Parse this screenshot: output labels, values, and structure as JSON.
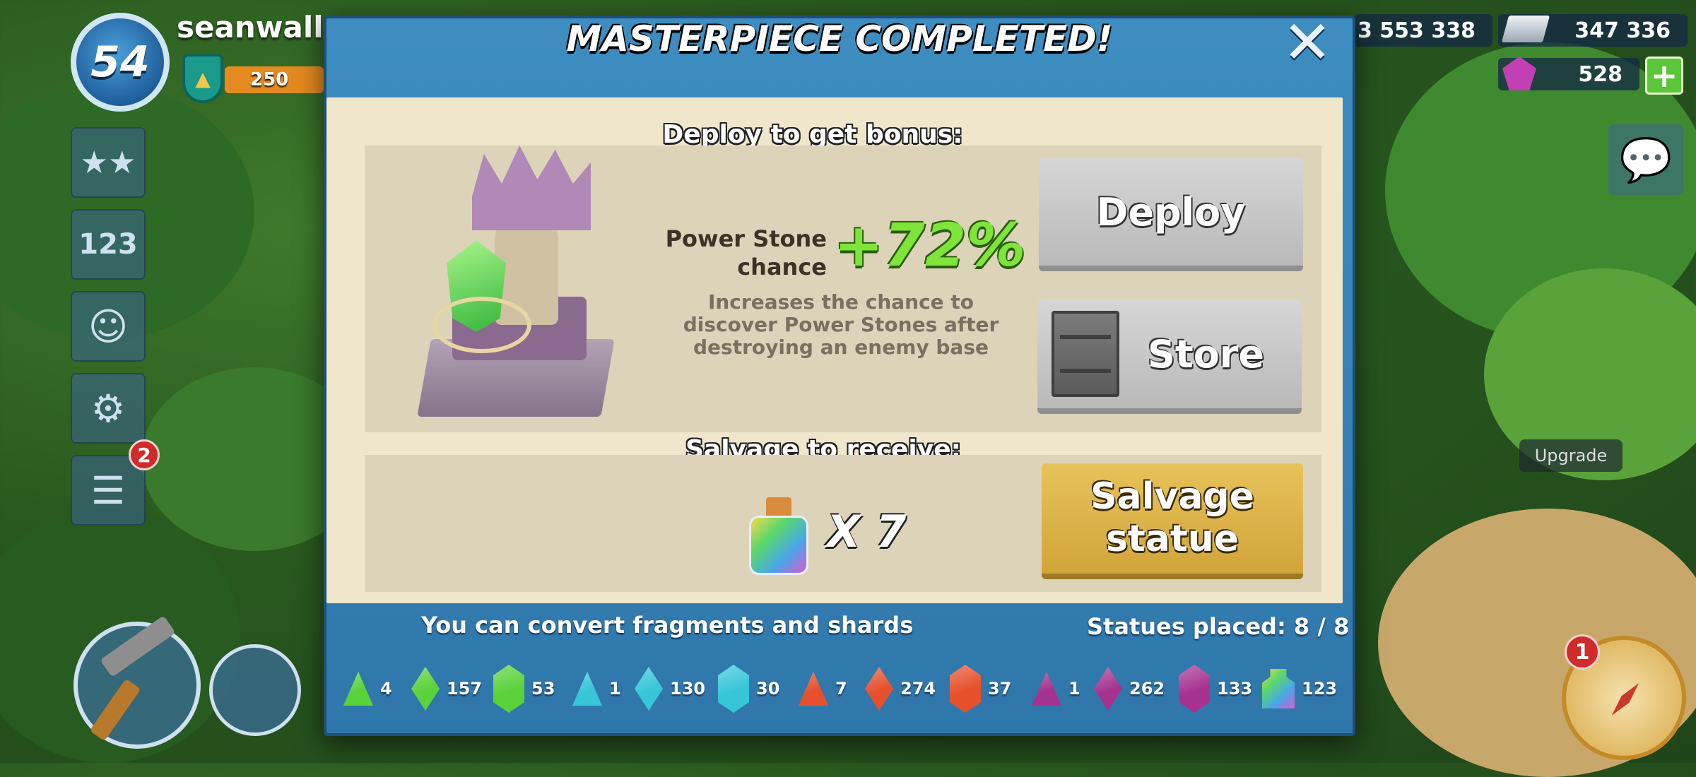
{
  "player": {
    "level": "54",
    "name": "seanwalla",
    "xp": "250"
  },
  "resources": {
    "gold": "3 553 338",
    "iron": "347 336",
    "gems": "528",
    "plus": "+"
  },
  "side_menu": {
    "news_badge": "2"
  },
  "right_hud": {
    "upgrade_label": "Upgrade",
    "map_badge": "1"
  },
  "modal": {
    "title": "MASTERPIECE COMPLETED!",
    "close": "✕",
    "deploy_section_label": "Deploy to get bonus:",
    "bonus": {
      "name": "Power Stone chance",
      "value": "+72%",
      "description": "Increases the chance to discover Power Stones after destroying an enemy base"
    },
    "deploy_button": "Deploy",
    "store_button": "Store",
    "salvage_section_label": "Salvage to receive:",
    "salvage_multiplier": "X 7",
    "salvage_button": "Salvage statue",
    "convert_text": "You can convert fragments and shards",
    "statues_placed": "Statues placed: 8 / 8",
    "inventory": [
      {
        "icon": "green-fragment-icon",
        "color": "#5bd13a",
        "count": "4"
      },
      {
        "icon": "green-shard-icon",
        "color": "#5bd13a",
        "count": "157"
      },
      {
        "icon": "green-crystal-icon",
        "color": "#5bd13a",
        "count": "53"
      },
      {
        "icon": "cyan-fragment-icon",
        "color": "#36c6d8",
        "count": "1"
      },
      {
        "icon": "cyan-shard-icon",
        "color": "#36c6d8",
        "count": "130"
      },
      {
        "icon": "cyan-crystal-icon",
        "color": "#36c6d8",
        "count": "30"
      },
      {
        "icon": "red-fragment-icon",
        "color": "#e6502b",
        "count": "7"
      },
      {
        "icon": "red-shard-icon",
        "color": "#e6502b",
        "count": "274"
      },
      {
        "icon": "red-crystal-icon",
        "color": "#e6502b",
        "count": "37"
      },
      {
        "icon": "purple-fragment-icon",
        "color": "#a6328f",
        "count": "1"
      },
      {
        "icon": "purple-shard-icon",
        "color": "#a6328f",
        "count": "262"
      },
      {
        "icon": "purple-crystal-icon",
        "color": "#a6328f",
        "count": "133"
      },
      {
        "icon": "idol-potion-icon",
        "color": "#e0a34a",
        "count": "123"
      }
    ]
  }
}
